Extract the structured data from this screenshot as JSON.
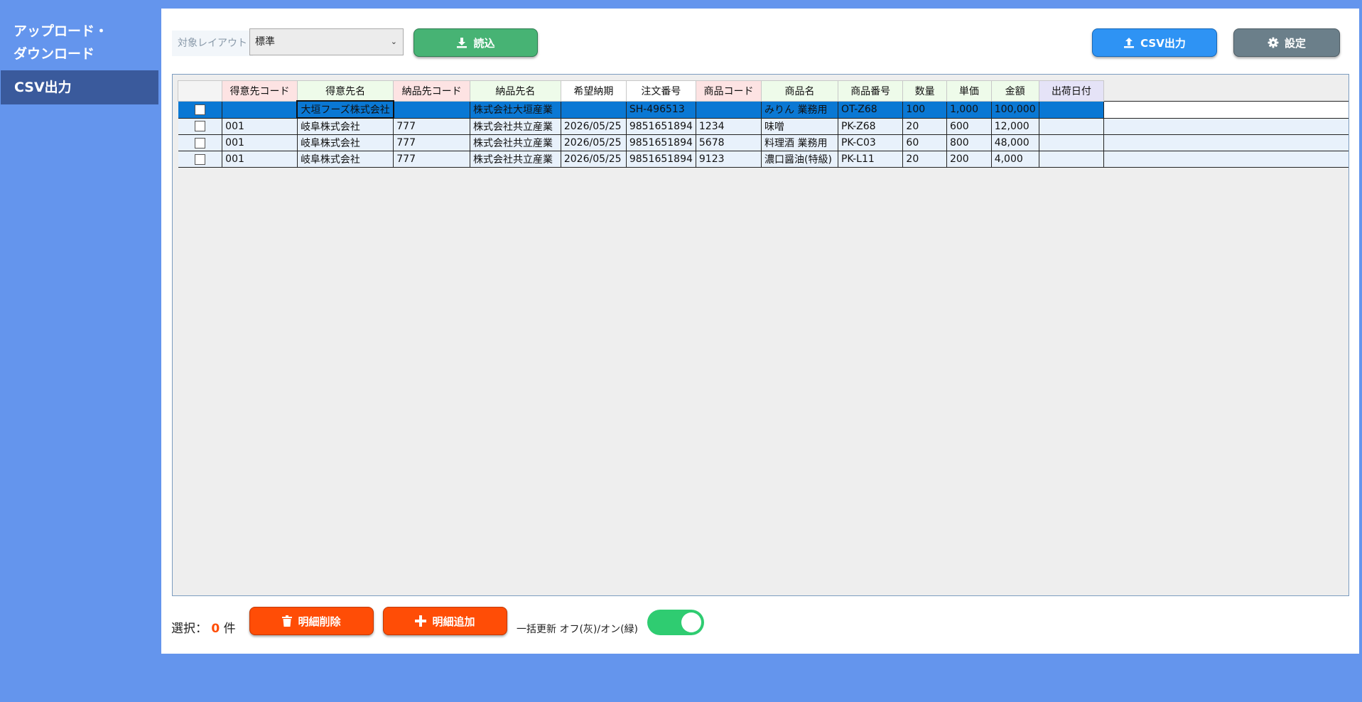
{
  "sidebar": {
    "upload_download_line1": "アップロード・",
    "upload_download_line2": "ダウンロード",
    "csv_output": "CSV出力"
  },
  "toolbar": {
    "layout_label": "対象レイアウト",
    "layout_value": "標準",
    "read_button": "読込",
    "csv_button": "CSV出力",
    "settings_button": "設定"
  },
  "grid": {
    "columns": [
      "",
      "得意先コード",
      "得意先名",
      "納品先コード",
      "納品先名",
      "希望納期",
      "注文番号",
      "商品コード",
      "商品名",
      "商品番号",
      "数量",
      "単価",
      "金額",
      "出荷日付"
    ],
    "rows": [
      [
        "",
        "大垣フーズ株式会社",
        "",
        "株式会社大垣産業",
        "",
        "SH-496513",
        "",
        "みりん 業務用",
        "OT-Z68",
        "100",
        "1,000",
        "100,000",
        ""
      ],
      [
        "001",
        "岐阜株式会社",
        "777",
        "株式会社共立産業",
        "2026/05/25",
        "9851651894",
        "1234",
        "味噌",
        "PK-Z68",
        "20",
        "600",
        "12,000",
        ""
      ],
      [
        "001",
        "岐阜株式会社",
        "777",
        "株式会社共立産業",
        "2026/05/25",
        "9851651894",
        "5678",
        "料理酒 業務用",
        "PK-C03",
        "60",
        "800",
        "48,000",
        ""
      ],
      [
        "001",
        "岐阜株式会社",
        "777",
        "株式会社共立産業",
        "2026/05/25",
        "9851651894",
        "9123",
        "濃口醤油(特級)",
        "PK-L11",
        "20",
        "200",
        "4,000",
        ""
      ]
    ]
  },
  "footer": {
    "selection_prefix": "選択：",
    "selection_count": "0",
    "selection_suffix": "件",
    "delete_button": "明細削除",
    "add_button": "明細追加",
    "bulk_update_label": "一括更新 オフ(灰)/オン(緑)",
    "bulk_update_on": true
  },
  "colors": {
    "background": "#6495ed",
    "sidebar_active": "#3a5a9c",
    "read_button": "#47b374",
    "csv_button": "#2e93f4",
    "settings_button": "#6b7f8a",
    "danger_button": "#ff4d06",
    "toggle_on": "#2fcc71",
    "selected_row": "#0a78d4"
  }
}
